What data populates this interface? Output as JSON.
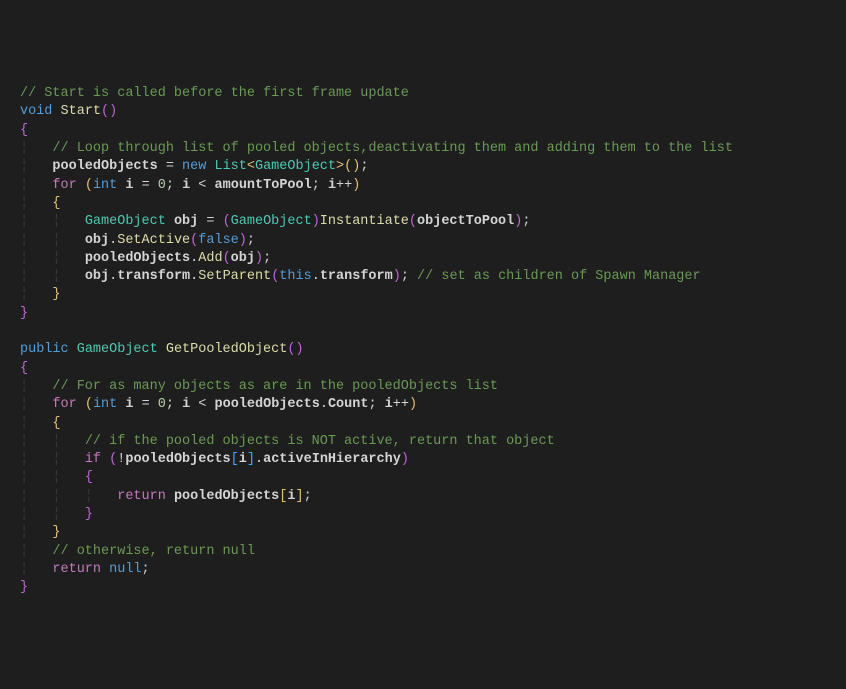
{
  "lines": {
    "l1_comment": "// Start is called before the first frame update",
    "l2_void": "void",
    "l2_start": "Start",
    "l2_pp": "()",
    "l3_brace": "{",
    "l4_comment": "// Loop through list of pooled objects,deactivating them and adding them to the list",
    "l5_pooled": "pooledObjects",
    "l5_eq": " = ",
    "l5_new": "new",
    "l5_sp": " ",
    "l5_list": "List",
    "l5_lt": "<",
    "l5_go": "GameObject",
    "l5_gt": ">",
    "l5_paren": "()",
    "l5_semi": ";",
    "l6_for": "for",
    "l6_sp": " ",
    "l6_lp": "(",
    "l6_int": "int",
    "l6_i": "i",
    "l6_eq": " = ",
    "l6_zero": "0",
    "l6_semi1": "; ",
    "l6_i2": "i",
    "l6_lt": " < ",
    "l6_atp": "amountToPool",
    "l6_semi2": "; ",
    "l6_i3": "i",
    "l6_inc": "++",
    "l6_rp": ")",
    "l7_brace": "{",
    "l8_go": "GameObject",
    "l8_obj": "obj",
    "l8_eq": " = ",
    "l8_lp": "(",
    "l8_go2": "GameObject",
    "l8_rp": ")",
    "l8_inst": "Instantiate",
    "l8_lp2": "(",
    "l8_otp": "objectToPool",
    "l8_rp2": ")",
    "l8_semi": ";",
    "l9_obj": "obj",
    "l9_dot": ".",
    "l9_sa": "SetActive",
    "l9_lp": "(",
    "l9_false": "false",
    "l9_rp": ")",
    "l9_semi": ";",
    "l10_po": "pooledObjects",
    "l10_dot": ".",
    "l10_add": "Add",
    "l10_lp": "(",
    "l10_obj": "obj",
    "l10_rp": ")",
    "l10_semi": ";",
    "l11_obj": "obj",
    "l11_dot1": ".",
    "l11_tr": "transform",
    "l11_dot2": ".",
    "l11_sp": "SetParent",
    "l11_lp": "(",
    "l11_this": "this",
    "l11_dot3": ".",
    "l11_tr2": "transform",
    "l11_rp": ")",
    "l11_semi": ";",
    "l11_comment": " // set as children of Spawn Manager",
    "l12_brace": "}",
    "l13_brace": "}",
    "l15_public": "public",
    "l15_go": "GameObject",
    "l15_gpo": "GetPooledObject",
    "l15_paren": "()",
    "l16_brace": "{",
    "l17_comment": "// For as many objects as are in the pooledObjects list",
    "l18_for": "for",
    "l18_sp": " ",
    "l18_lp": "(",
    "l18_int": "int",
    "l18_i": "i",
    "l18_eq": " = ",
    "l18_zero": "0",
    "l18_semi1": "; ",
    "l18_i2": "i",
    "l18_lt": " < ",
    "l18_po": "pooledObjects",
    "l18_dot": ".",
    "l18_count": "Count",
    "l18_semi2": "; ",
    "l18_i3": "i",
    "l18_inc": "++",
    "l18_rp": ")",
    "l19_brace": "{",
    "l20_comment": "// if the pooled objects is NOT active, return that object",
    "l21_if": "if",
    "l21_sp": " ",
    "l21_lp": "(",
    "l21_not": "!",
    "l21_po": "pooledObjects",
    "l21_lb": "[",
    "l21_i": "i",
    "l21_rb": "]",
    "l21_dot": ".",
    "l21_aih": "activeInHierarchy",
    "l21_rp": ")",
    "l22_brace": "{",
    "l23_return": "return",
    "l23_po": "pooledObjects",
    "l23_lb": "[",
    "l23_i": "i",
    "l23_rb": "]",
    "l23_semi": ";",
    "l24_brace": "}",
    "l25_brace": "}",
    "l26_comment": "// otherwise, return null",
    "l27_return": "return",
    "l27_null": "null",
    "l27_semi": ";",
    "l28_brace": "}"
  }
}
